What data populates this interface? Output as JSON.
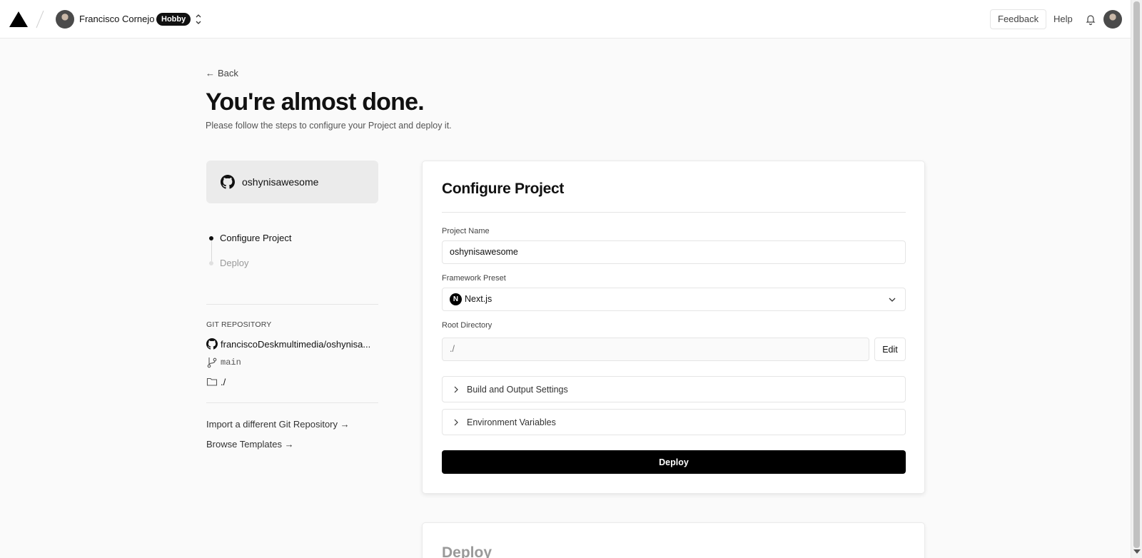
{
  "topbar": {
    "team_name": "Francisco Cornejo",
    "plan_badge": "Hobby",
    "feedback_label": "Feedback",
    "help_label": "Help"
  },
  "header": {
    "back_label": "Back",
    "title": "You're almost done.",
    "subtitle": "Please follow the steps to configure your Project and deploy it."
  },
  "repo_card": {
    "name": "oshynisawesome"
  },
  "steps": [
    {
      "label": "Configure Project",
      "state": "active"
    },
    {
      "label": "Deploy",
      "state": "inactive"
    }
  ],
  "git": {
    "section_label": "GIT REPOSITORY",
    "repository": "franciscoDeskmultimedia/oshynisa...",
    "branch": "main",
    "directory": "./"
  },
  "links": {
    "import_different": "Import a different Git Repository →",
    "browse_templates": "Browse Templates →"
  },
  "configure": {
    "title": "Configure Project",
    "project_name_label": "Project Name",
    "project_name_value": "oshynisawesome",
    "framework_label": "Framework Preset",
    "framework_value": "Next.js",
    "framework_logo_letter": "N",
    "root_dir_label": "Root Directory",
    "root_dir_value": "./",
    "edit_label": "Edit",
    "build_settings_label": "Build and Output Settings",
    "env_vars_label": "Environment Variables",
    "deploy_label": "Deploy"
  },
  "deploy_section": {
    "title": "Deploy"
  },
  "icons": {
    "logo": "vercel-triangle-icon",
    "switcher": "chevron-up-down-icon",
    "notifications": "bell-icon",
    "github": "github-icon",
    "branch": "git-branch-icon",
    "folder": "folder-icon"
  },
  "colors": {
    "accent": "#000000",
    "background": "#fafafa"
  }
}
